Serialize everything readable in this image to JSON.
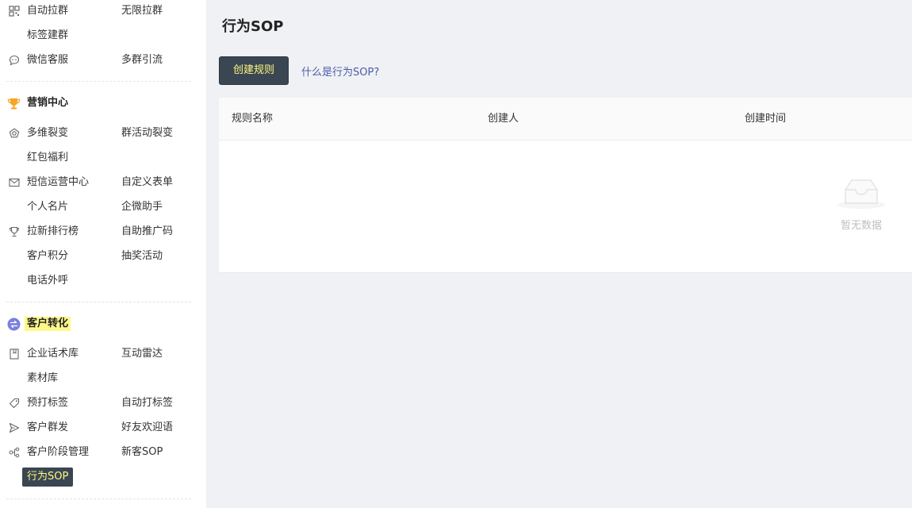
{
  "sidebar": {
    "rows_top": [
      {
        "icon": "qrcode-icon",
        "col1": "自动拉群",
        "col2": "无限拉群"
      },
      {
        "icon": null,
        "col1": "标签建群",
        "col2": null
      },
      {
        "icon": "chat-bubble-icon",
        "col1": "微信客服",
        "col2": "多群引流"
      }
    ],
    "marketing": {
      "title": "营销中心",
      "icon": "trophy-icon",
      "icon_color": "#f5a623",
      "rows": [
        {
          "icon": "pentagon-icon",
          "col1": "多维裂变",
          "col2": "群活动裂变"
        },
        {
          "icon": null,
          "col1": "红包福利",
          "col2": null
        },
        {
          "icon": "mail-icon",
          "col1": "短信运营中心",
          "col2": "自定义表单"
        },
        {
          "icon": null,
          "col1": "个人名片",
          "col2": "企微助手"
        },
        {
          "icon": "cup-icon",
          "col1": "拉新排行榜",
          "col2": "自助推广码"
        },
        {
          "icon": null,
          "col1": "客户积分",
          "col2": "抽奖活动"
        },
        {
          "icon": null,
          "col1": "电话外呼",
          "col2": null
        }
      ]
    },
    "conversion": {
      "title": "客户转化",
      "icon": "exchange-icon",
      "icon_color": "#7a7fe0",
      "rows": [
        {
          "icon": "book-icon",
          "col1": "企业话术库",
          "col2": "互动雷达"
        },
        {
          "icon": null,
          "col1": "素材库",
          "col2": null
        },
        {
          "icon": "tag-icon",
          "col1": "预打标签",
          "col2": "自动打标签"
        },
        {
          "icon": "send-icon",
          "col1": "客户群发",
          "col2": "好友欢迎语"
        },
        {
          "icon": "flow-icon",
          "col1": "客户阶段管理",
          "col2": "新客SOP"
        }
      ],
      "active_item": "行为SOP"
    }
  },
  "main": {
    "title": "行为SOP",
    "create_button": "创建规则",
    "help_link": "什么是行为SOP?",
    "table": {
      "columns": [
        "规则名称",
        "创建人",
        "创建时间"
      ],
      "empty_text": "暂无数据"
    }
  },
  "colors": {
    "dark_button": "#3b4653",
    "accent_yellow": "#fff880",
    "link": "#4a5da8"
  }
}
